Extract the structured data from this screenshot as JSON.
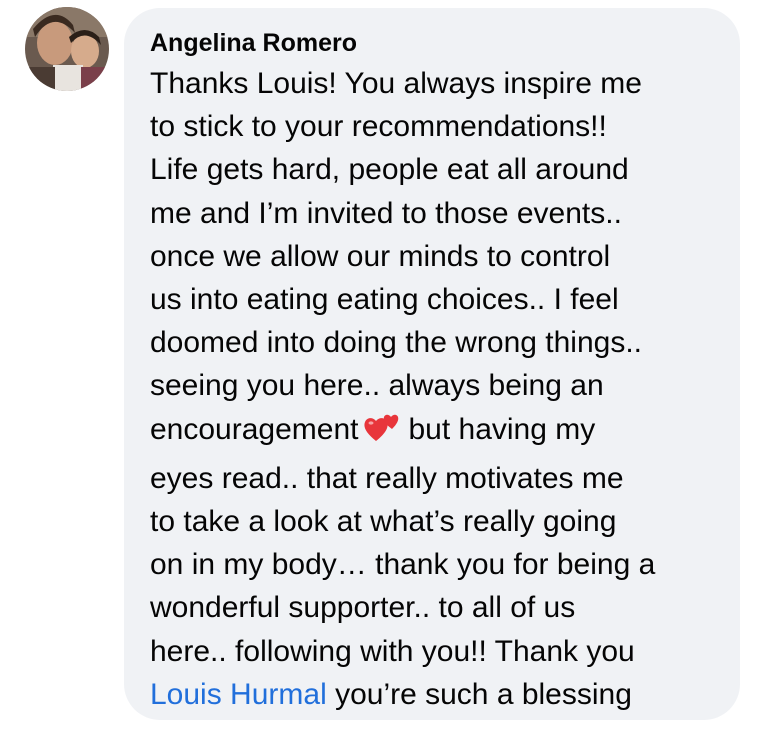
{
  "comment": {
    "author": "Angelina Romero",
    "lines_before_emoji": [
      "Thanks Louis! You always inspire me",
      "to stick to your recommendations!!",
      "Life gets hard, people eat all around",
      "me and I’m invited to those events..",
      "once we allow our minds to control",
      "us into eating eating choices.. I feel",
      "doomed into doing the wrong things..",
      "seeing you here.. always being an"
    ],
    "emoji_line_prefix": "encouragement",
    "emoji_icon": "two-hearts-icon",
    "emoji_line_suffix": "but having my",
    "lines_after_emoji": [
      "eyes read.. that really motivates me",
      "to take a look at what’s really going",
      "on in my body… thank you for being a",
      "wonderful supporter.. to all of us",
      "here.. following with you!! Thank you"
    ],
    "mention": "Louis Hurmal",
    "final_suffix": " you’re such a blessing"
  },
  "colors": {
    "bubble": "#f0f2f5",
    "text": "#050505",
    "mention": "#216fdb",
    "heart": "#e8353b"
  }
}
